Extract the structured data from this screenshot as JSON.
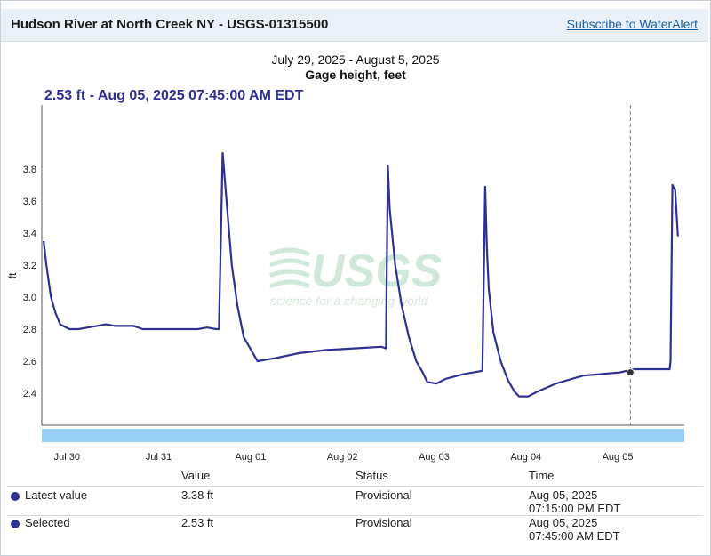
{
  "header": {
    "site_title": "Hudson River at North Creek NY - USGS-01315500",
    "subscribe_label": "Subscribe to WaterAlert"
  },
  "chart_header": {
    "date_range": "July 29, 2025 - August 5, 2025",
    "parameter": "Gage height, feet",
    "selected_readout": "2.53 ft - Aug 05, 2025 07:45:00 AM EDT"
  },
  "watermark": {
    "logo_text": "USGS",
    "tagline": "science for a changing world"
  },
  "colors": {
    "series": "#2e3192",
    "axis": "#555555",
    "navigator": "#99d0f7",
    "accent_link": "#1a5fa8"
  },
  "chart_data": {
    "type": "line",
    "title": "Gage height, feet",
    "subtitle": "July 29, 2025 - August 5, 2025",
    "xlabel": "",
    "ylabel": "ft",
    "x_unit": "days since Jul 30 00:00",
    "xlim": [
      -0.1,
      6.9
    ],
    "ylim": [
      2.2,
      4.2
    ],
    "xticks": [
      {
        "value": 0,
        "label": "Jul 30"
      },
      {
        "value": 1,
        "label": "Jul 31"
      },
      {
        "value": 2,
        "label": "Aug 01"
      },
      {
        "value": 3,
        "label": "Aug 02"
      },
      {
        "value": 4,
        "label": "Aug 03"
      },
      {
        "value": 5,
        "label": "Aug 04"
      },
      {
        "value": 6,
        "label": "Aug 05"
      }
    ],
    "yticks": [
      2.4,
      2.6,
      2.8,
      3.0,
      3.2,
      3.4,
      3.6,
      3.8
    ],
    "series": [
      {
        "x": [
          -0.08,
          -0.05,
          0.0,
          0.05,
          0.1,
          0.2,
          0.3,
          0.4,
          0.5,
          0.6,
          0.7,
          0.8,
          0.9,
          1.0,
          1.2,
          1.4,
          1.6,
          1.7,
          1.8,
          1.83,
          1.87,
          1.92,
          1.97,
          2.03,
          2.1,
          2.25,
          2.45,
          2.7,
          3.0,
          3.3,
          3.6,
          3.65,
          3.67,
          3.69,
          3.75,
          3.82,
          3.9,
          3.98,
          4.05,
          4.1,
          4.2,
          4.3,
          4.5,
          4.7,
          4.73,
          4.75,
          4.77,
          4.82,
          4.9,
          4.98,
          5.05,
          5.1,
          5.2,
          5.3,
          5.5,
          5.8,
          6.2,
          6.35,
          6.6,
          6.74,
          6.75,
          6.77,
          6.8,
          6.83
        ],
        "y": [
          3.35,
          3.2,
          3.0,
          2.9,
          2.83,
          2.8,
          2.8,
          2.81,
          2.82,
          2.83,
          2.82,
          2.82,
          2.82,
          2.8,
          2.8,
          2.8,
          2.8,
          2.81,
          2.8,
          2.8,
          3.9,
          3.55,
          3.2,
          2.95,
          2.75,
          2.6,
          2.62,
          2.65,
          2.67,
          2.68,
          2.69,
          2.68,
          3.82,
          3.55,
          3.2,
          2.95,
          2.75,
          2.6,
          2.53,
          2.47,
          2.46,
          2.49,
          2.52,
          2.54,
          3.69,
          3.3,
          3.05,
          2.78,
          2.6,
          2.48,
          2.41,
          2.38,
          2.38,
          2.41,
          2.46,
          2.51,
          2.53,
          2.55,
          2.55,
          2.55,
          2.6,
          3.7,
          3.67,
          3.38
        ]
      }
    ],
    "selected_point": {
      "x": 6.3125,
      "y": 2.53,
      "label": "Aug 05, 2025 07:45:00 AM EDT"
    },
    "grid": false,
    "legend": "none"
  },
  "table": {
    "headers": [
      "Value",
      "Status",
      "Time"
    ],
    "rows": [
      {
        "label": "Latest value",
        "value": "3.38 ft",
        "status": "Provisional",
        "date": "Aug 05, 2025",
        "time": "07:15:00 PM EDT"
      },
      {
        "label": "Selected",
        "value": "2.53 ft",
        "status": "Provisional",
        "date": "Aug 05, 2025",
        "time": "07:45:00 AM EDT"
      }
    ]
  }
}
